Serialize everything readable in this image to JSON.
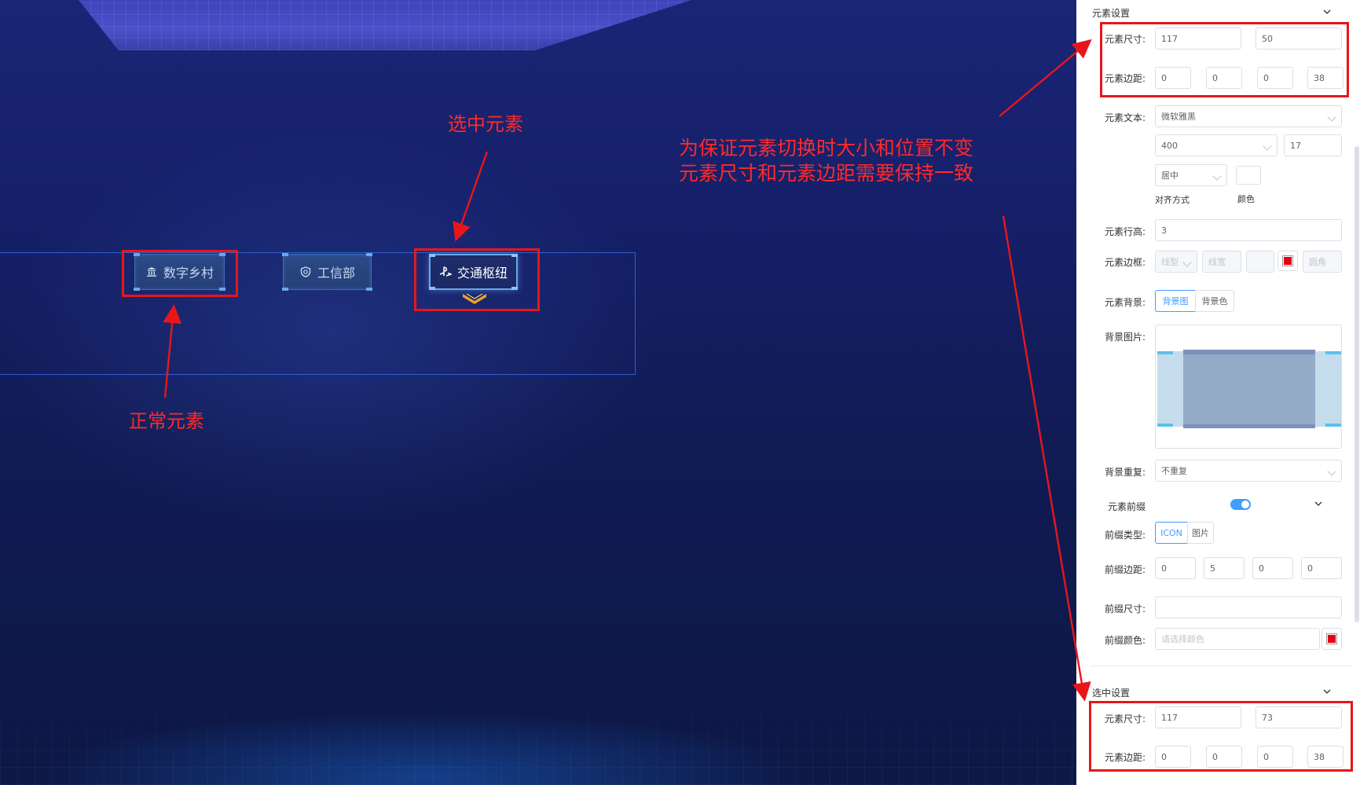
{
  "canvas": {
    "nav_buttons": [
      {
        "label": "数字乡村",
        "icon": "bank-icon",
        "state": "normal"
      },
      {
        "label": "工信部",
        "icon": "shield-icon",
        "state": "normal"
      },
      {
        "label": "交通枢纽",
        "icon": "playstation-icon",
        "state": "selected"
      }
    ],
    "annotations": {
      "selected_element": "选中元素",
      "normal_element": "正常元素",
      "note_line1": "为保证元素切换时大小和位置不变",
      "note_line2": "元素尺寸和元素边距需要保持一致"
    }
  },
  "panel": {
    "element_settings": {
      "title": "元素设置",
      "size_label": "元素尺寸:",
      "size_width": "117",
      "size_height": "50",
      "margin_label": "元素边距:",
      "margin": [
        "0",
        "0",
        "0",
        "38"
      ],
      "text_label": "元素文本:",
      "font_family": "微软雅黑",
      "font_weight": "400",
      "font_size": "17",
      "align_value": "居中",
      "align_caption": "对齐方式",
      "color_caption": "颜色",
      "line_height_label": "元素行高:",
      "line_height": "3",
      "border_label": "元素边框:",
      "border_type_placeholder": "线型",
      "border_width_placeholder": "线宽",
      "border_radius_placeholder": "圆角",
      "background_label": "元素背景:",
      "background_tabs": [
        "背景图",
        "背景色"
      ],
      "bg_image_label": "背景图片:",
      "bg_repeat_label": "背景重复:",
      "bg_repeat_value": "不重复",
      "prefix_label": "元素前缀",
      "prefix_enabled": true,
      "prefix_type_label": "前缀类型:",
      "prefix_type_tabs": [
        "ICON",
        "图片"
      ],
      "prefix_margin_label": "前缀边距:",
      "prefix_margin": [
        "0",
        "5",
        "0",
        "0"
      ],
      "prefix_size_label": "前缀尺寸:",
      "prefix_color_label": "前缀颜色:",
      "prefix_color_placeholder": "请选择颜色"
    },
    "selected_settings": {
      "title": "选中设置",
      "size_label": "元素尺寸:",
      "size_width": "117",
      "size_height": "73",
      "margin_label": "元素边距:",
      "margin": [
        "0",
        "0",
        "0",
        "38"
      ]
    },
    "colors": {
      "accent": "#409eff",
      "swatch": "#e60012",
      "annotation_red": "#e8161a"
    }
  }
}
